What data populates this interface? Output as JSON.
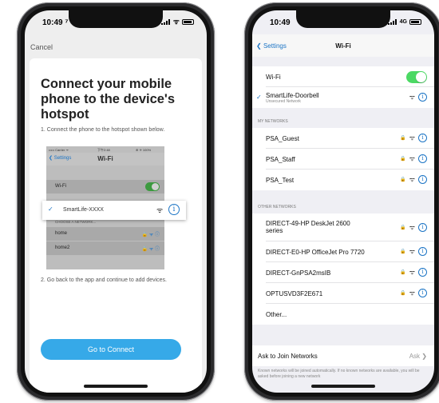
{
  "left_phone": {
    "status": {
      "time": "10:49 ⁷"
    },
    "cancel_label": "Cancel",
    "title": "Connect your mobile phone to the device's hotspot",
    "step1": "1. Connect the phone to the hotspot shown below.",
    "illustration": {
      "carrier": "••••• Carrier ᯤ",
      "time": "下午2:48",
      "battery": "⊕ ✈ 100%",
      "back_label": "Settings",
      "title": "Wi-Fi",
      "wifi_label": "Wi-Fi",
      "section_header": "CHOOSE A NETWORK...",
      "networks": [
        "home",
        "home2"
      ]
    },
    "popup": {
      "network": "SmartLife-XXXX"
    },
    "step2": "2. Go back to the app and continue to add devices.",
    "connect_button": "Go to Connect"
  },
  "right_phone": {
    "status": {
      "time": "10:49",
      "network": "4G"
    },
    "nav": {
      "back_label": "Settings",
      "title": "Wi-Fi"
    },
    "wifi_row_label": "Wi-Fi",
    "wifi_enabled": true,
    "connected": {
      "name": "SmartLife-Doorbell",
      "sub": "Unsecured Network"
    },
    "my_networks_header": "MY NETWORKS",
    "my_networks": [
      "PSA_Guest",
      "PSA_Staff",
      "PSA_Test"
    ],
    "other_networks_header": "OTHER NETWORKS",
    "other_networks": [
      "DIRECT-49-HP DeskJet 2600 series",
      "DIRECT-E0-HP OfficeJet Pro 7720",
      "DIRECT-GnPSA2msIB",
      "OPTUSVD3F2E671"
    ],
    "other_label": "Other...",
    "ask_label": "Ask to Join Networks",
    "ask_value": "Ask",
    "footer": "Known networks will be joined automatically. If no known networks are available, you will be asked before joining a new network"
  },
  "colors": {
    "accent": "#1b74c5",
    "button": "#36a9e8",
    "toggle_on": "#4cd964"
  }
}
